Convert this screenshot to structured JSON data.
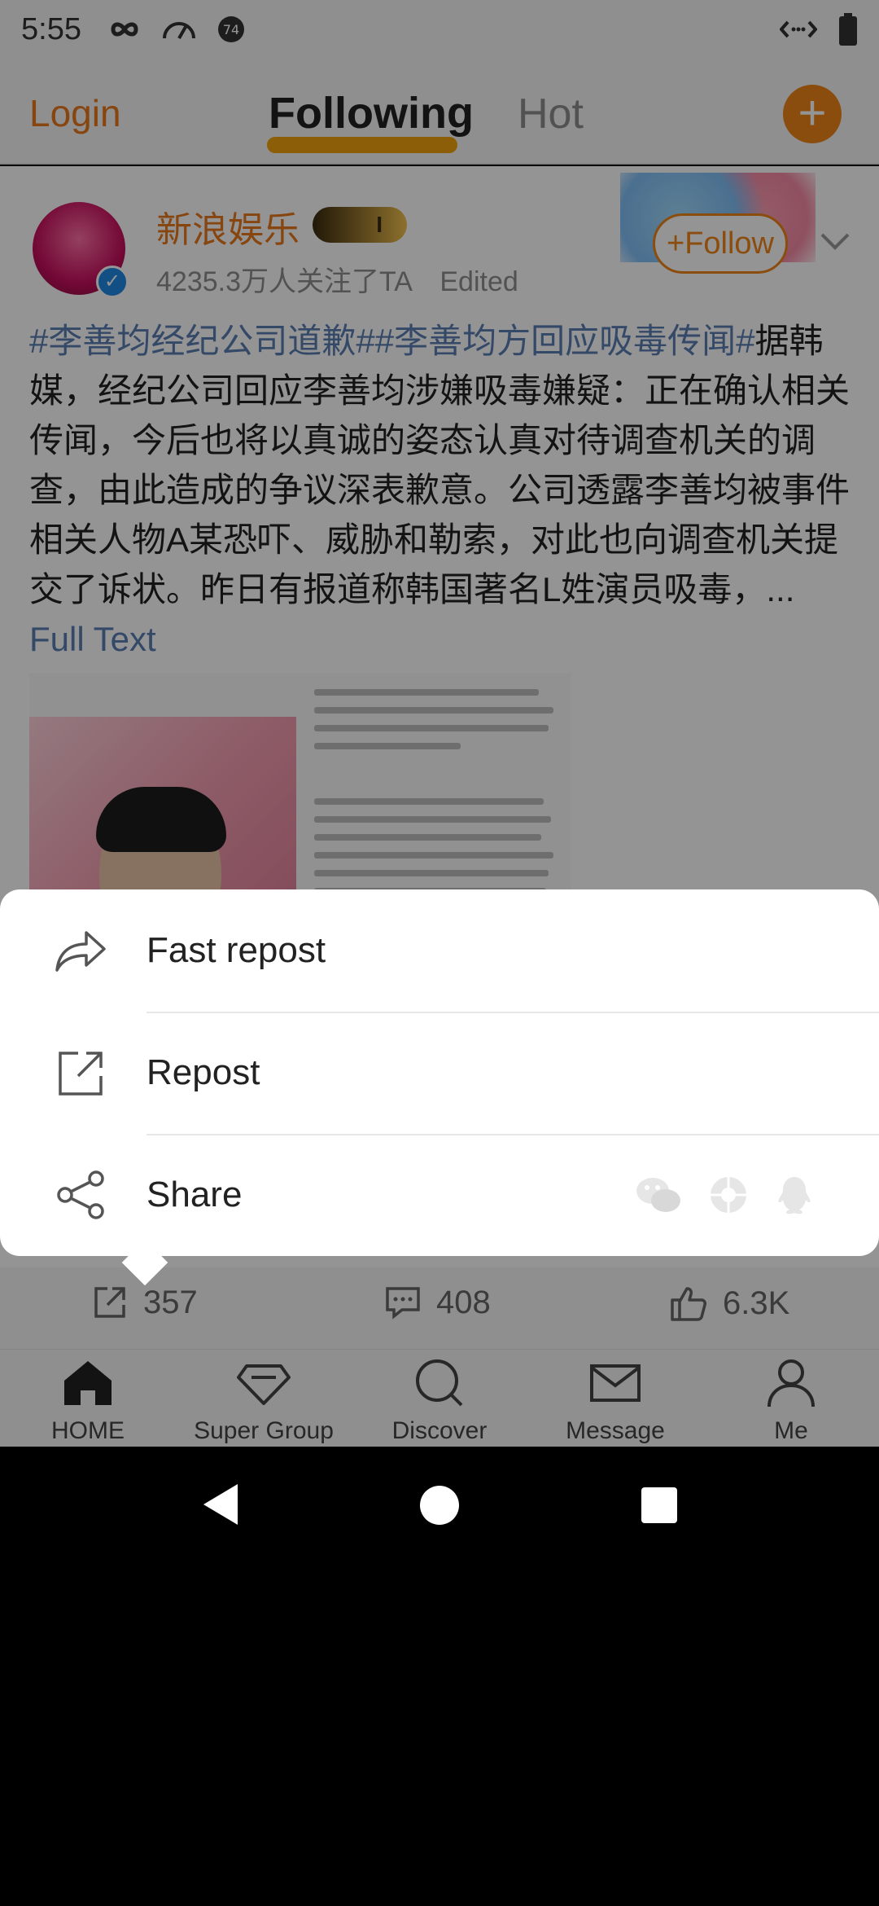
{
  "status": {
    "time": "5:55",
    "badge_count": "74"
  },
  "header": {
    "login": "Login",
    "tab_following": "Following",
    "tab_hot": "Hot"
  },
  "post": {
    "username": "新浪娱乐",
    "vip_level": "I",
    "followers": "4235.3万人关注了TA",
    "edited": "Edited",
    "follow_label": "Follow",
    "hashtag_1": "#李善均经纪公司道歉#",
    "hashtag_2": "#李善均方回应吸毒传闻#",
    "body": "据韩媒，经纪公司回应李善均涉嫌吸毒嫌疑：正在确认相关传闻，今后也将以真诚的姿态认真对待调查机关的调查，由此造成的争议深表歉意。公司透露李善均被事件相关人物A某恐吓、威胁和勒索，对此也向调查机关提交了诉状。昨日有报道称韩国著名L姓演员吸毒，",
    "ellipsis": "... ",
    "full_text": "Full Text"
  },
  "sheet": {
    "fast_repost": "Fast repost",
    "repost": "Repost",
    "share": "Share",
    "share_apps": [
      "wechat-icon",
      "moments-icon",
      "qq-icon"
    ]
  },
  "actions": {
    "reposts": "357",
    "comments": "408",
    "likes": "6.3K"
  },
  "nav": [
    {
      "label": "HOME",
      "icon": "home-icon"
    },
    {
      "label": "Super Group",
      "icon": "diamond-icon"
    },
    {
      "label": "Discover",
      "icon": "search-icon"
    },
    {
      "label": "Message",
      "icon": "envelope-icon"
    },
    {
      "label": "Me",
      "icon": "person-icon"
    }
  ],
  "colors": {
    "accent": "#f08519",
    "link": "#5b7fb4",
    "dim_overlay": "rgba(0,0,0,0.42)"
  }
}
